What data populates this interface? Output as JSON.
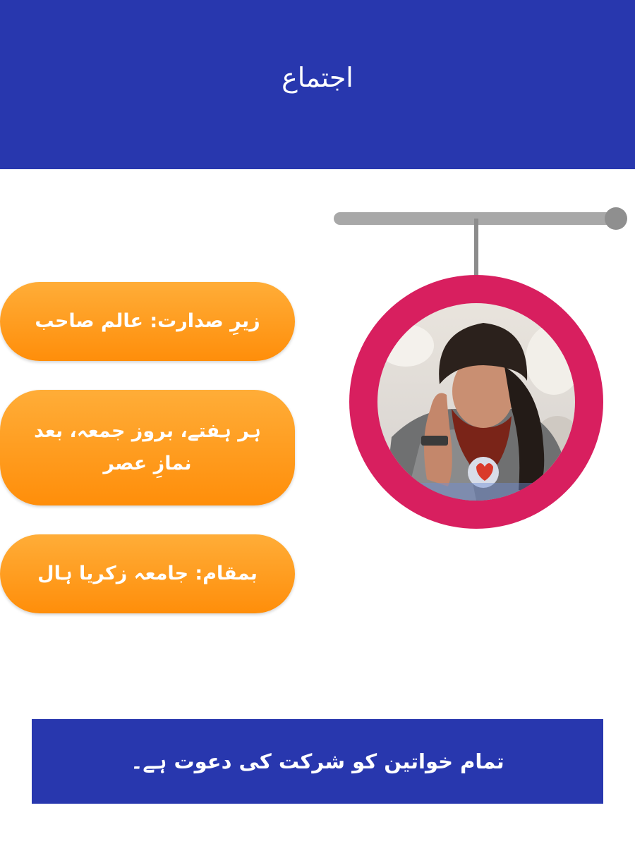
{
  "header": {
    "title": "اجتماع"
  },
  "details": {
    "presided_by": "زیرِ صدارت: عالم صاحب",
    "schedule": "ہر ہفتے، بروز جمعہ، بعد نمازِ عصر",
    "venue": "بمقام: جامعہ زکریا ہال"
  },
  "footer": {
    "invitation": "تمام خواتین کو شرکت کی دعوت ہے۔"
  },
  "colors": {
    "header_bg": "#2837ae",
    "ring": "#d81f5f",
    "pill": "#ff9a1f",
    "hanger": "#a8a8a8"
  },
  "icons": {
    "portrait": "portrait-photo",
    "hanger": "hanger-bar"
  }
}
